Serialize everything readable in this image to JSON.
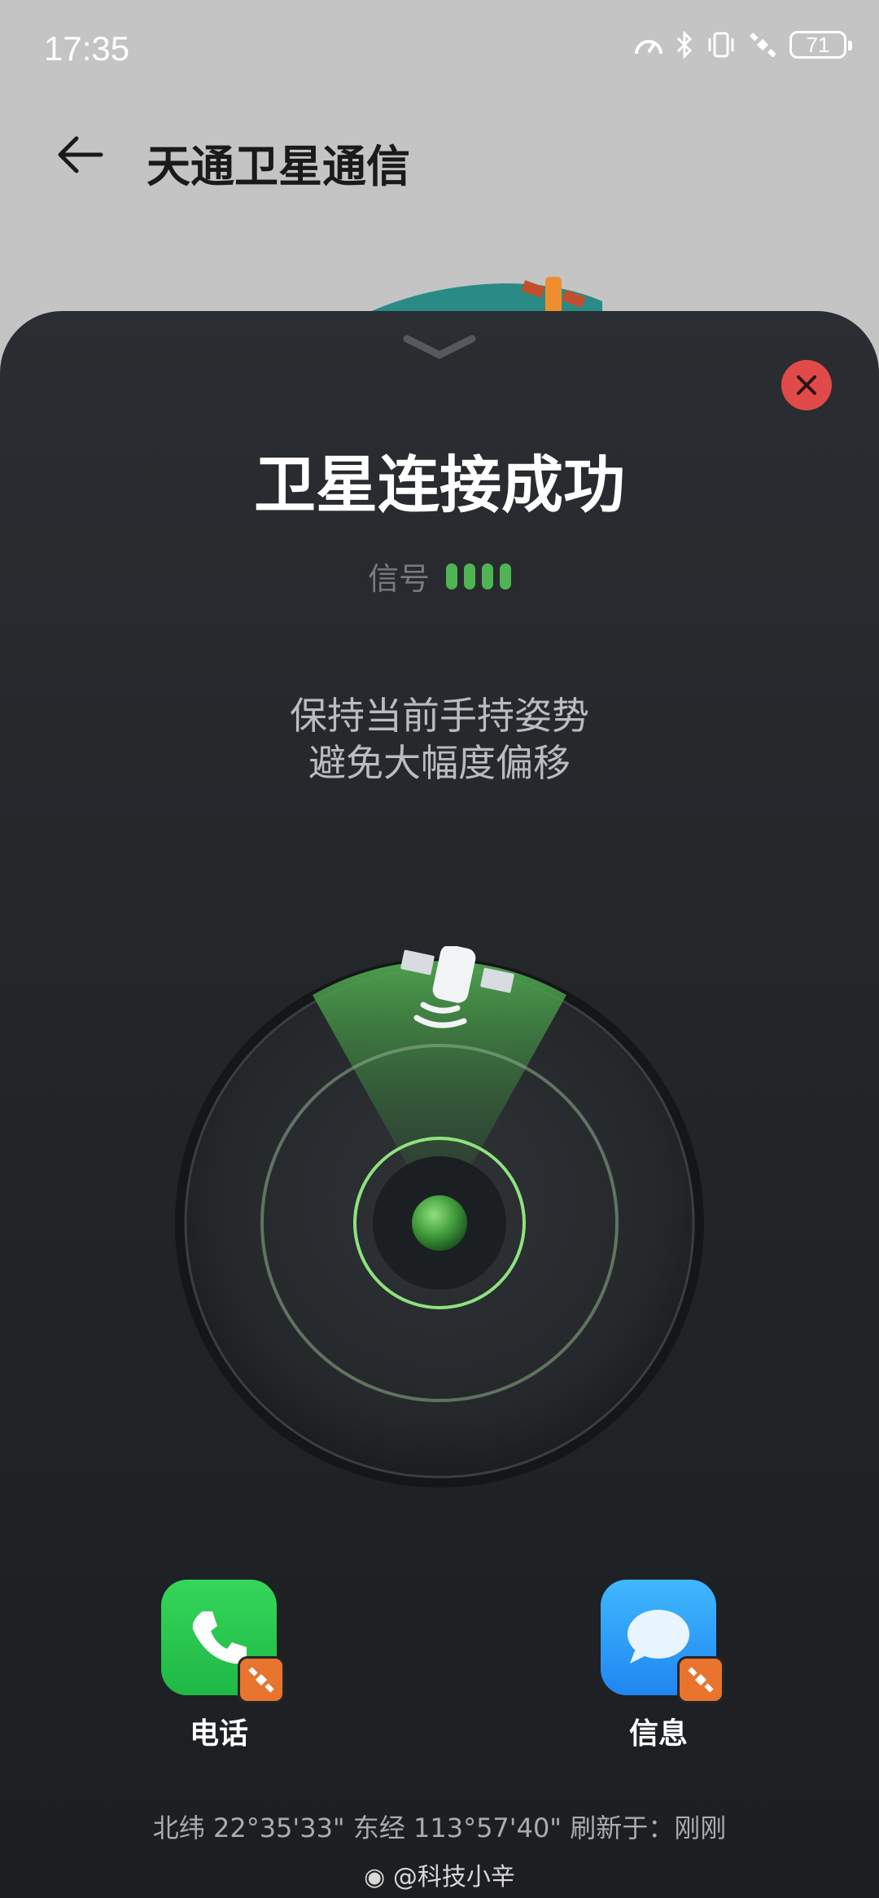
{
  "status": {
    "time": "17:35",
    "battery": "71"
  },
  "appbar": {
    "title": "天通卫星通信"
  },
  "sheet": {
    "title": "卫星连接成功",
    "signal_label": "信号",
    "signal_bars": 4,
    "hint_line1": "保持当前手持姿势",
    "hint_line2": "避免大幅度偏移"
  },
  "apps": {
    "phone_label": "电话",
    "messages_label": "信息"
  },
  "location": {
    "text": "北纬 22°35'33\" 东经 113°57'40\" 刷新于：刚刚"
  },
  "watermark": {
    "text": "@科技小辛"
  },
  "colors": {
    "accent_green": "#4fb552",
    "close_red": "#e04a48",
    "badge_orange": "#e8742e"
  }
}
